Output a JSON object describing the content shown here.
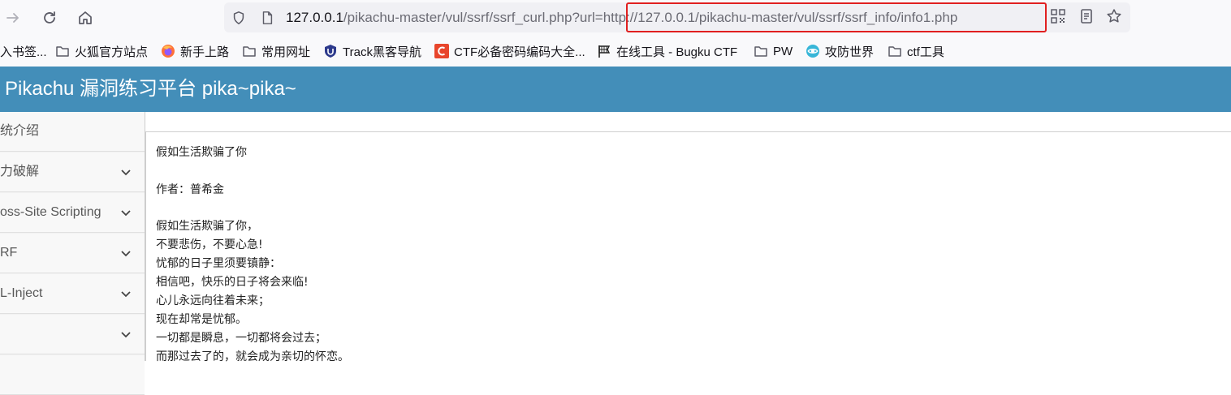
{
  "browser": {
    "url_host": "127.0.0.1",
    "url_path_before_highlight": "/pikachu-master/vul/ssrf/ssrf_curl.php?url",
    "url_highlight": "=http://127.0.0.1/pikachu-master/vul/ssrf/ssrf_info/info1.php",
    "highlight_color": "#e02020",
    "icons": [
      "forward-icon",
      "reload-icon",
      "home-icon",
      "shield-icon",
      "page-icon",
      "qr-code-icon",
      "reader-view-icon",
      "bookmark-star-icon"
    ]
  },
  "bookmarks": [
    {
      "label": "入书签...",
      "icon": "import-icon"
    },
    {
      "label": "火狐官方站点",
      "icon": "folder-icon"
    },
    {
      "label": "新手上路",
      "icon": "firefox-icon"
    },
    {
      "label": "常用网址",
      "icon": "folder-icon"
    },
    {
      "label": "Track黑客导航",
      "icon": "shield-badge-icon"
    },
    {
      "label": "CTF必备密码编码大全...",
      "icon": "c-badge-icon"
    },
    {
      "label": "在线工具 - Bugku CTF",
      "icon": "flag-icon"
    },
    {
      "label": "PW",
      "icon": "folder-icon"
    },
    {
      "label": "攻防世界",
      "icon": "globe-icon"
    },
    {
      "label": "ctf工具",
      "icon": "folder-icon"
    }
  ],
  "app": {
    "title": "Pikachu 漏洞练习平台 pika~pika~",
    "header_color": "#438eb9"
  },
  "sidebar": {
    "items": [
      {
        "label": "统介绍",
        "has_arrow": false
      },
      {
        "label": "力破解",
        "has_arrow": true
      },
      {
        "label": "oss-Site Scripting",
        "has_arrow": true
      },
      {
        "label": "RF",
        "has_arrow": true
      },
      {
        "label": "L-Inject",
        "has_arrow": true
      },
      {
        "label": "",
        "has_arrow": true
      },
      {
        "label": "",
        "has_arrow": false
      }
    ]
  },
  "poem": {
    "title": "假如生活欺骗了你",
    "author": "作者：普希金",
    "lines": [
      "假如生活欺骗了你，",
      "不要悲伤，不要心急!",
      "忧郁的日子里须要镇静：",
      "相信吧，快乐的日子将会来临!",
      "心儿永远向往着未来；",
      "现在却常是忧郁。",
      "一切都是瞬息，一切都将会过去；",
      "而那过去了的，就会成为亲切的怀恋。"
    ]
  }
}
